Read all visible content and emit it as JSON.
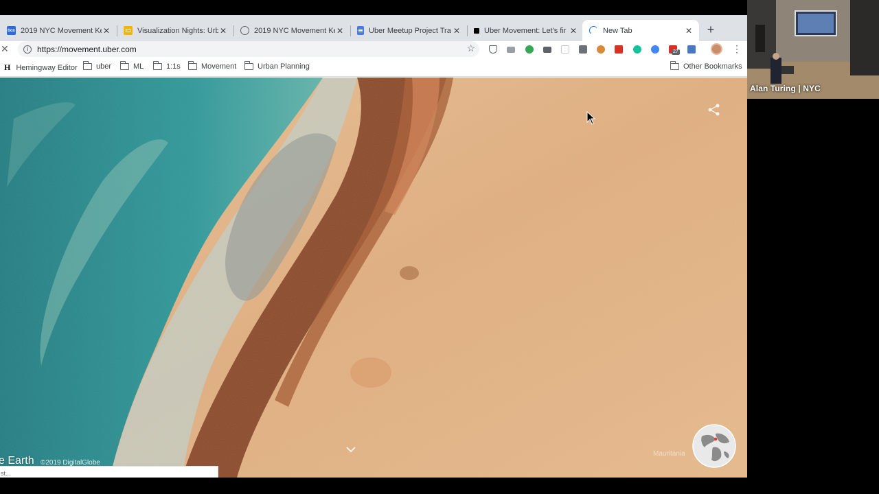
{
  "browser": {
    "tabs": [
      {
        "title": "2019 NYC Movement Ke",
        "favicon": "box-favicon",
        "favicon_color": "#2f6bd6",
        "active": false
      },
      {
        "title": "Visualization Nights: Urb",
        "favicon": "slides-favicon",
        "favicon_color": "#f4b400",
        "active": false
      },
      {
        "title": "2019 NYC Movement Ke",
        "favicon": "globe-favicon",
        "favicon_color": "#5f6368",
        "active": false
      },
      {
        "title": "Uber Meetup Project Tra",
        "favicon": "docs-favicon",
        "favicon_color": "#4a78e8",
        "active": false
      },
      {
        "title": "Uber Movement: Let's fir",
        "favicon": "uber-favicon",
        "favicon_color": "#000000",
        "active": false
      },
      {
        "title": "New Tab",
        "favicon": "loading-spinner",
        "favicon_color": "#1a73e8",
        "active": true
      }
    ],
    "new_tab_symbol": "+",
    "url": "https://movement.uber.com",
    "extension_badge": "27",
    "bookmarks": [
      {
        "label": "Hemingway Editor",
        "icon": "hemingway-h"
      },
      {
        "label": "uber",
        "icon": "folder-icon"
      },
      {
        "label": "ML",
        "icon": "folder-icon"
      },
      {
        "label": "1:1s",
        "icon": "folder-icon"
      },
      {
        "label": "Movement",
        "icon": "folder-icon"
      },
      {
        "label": "Urban Planning",
        "icon": "folder-icon"
      }
    ],
    "hemingway_letter": "H",
    "other_bookmarks": "Other Bookmarks"
  },
  "page": {
    "brand_partial": "e Earth",
    "copyright": "©2019 DigitalGlobe",
    "region_label": "Mauritania",
    "status_text": "st..."
  },
  "webcam": {
    "label": "Alan Turing | NYC"
  },
  "colors": {
    "ocean": "#1f8a92",
    "sand": "#e6b98c",
    "shore": "#8a4a2e",
    "tabbar": "#dee1e6"
  }
}
